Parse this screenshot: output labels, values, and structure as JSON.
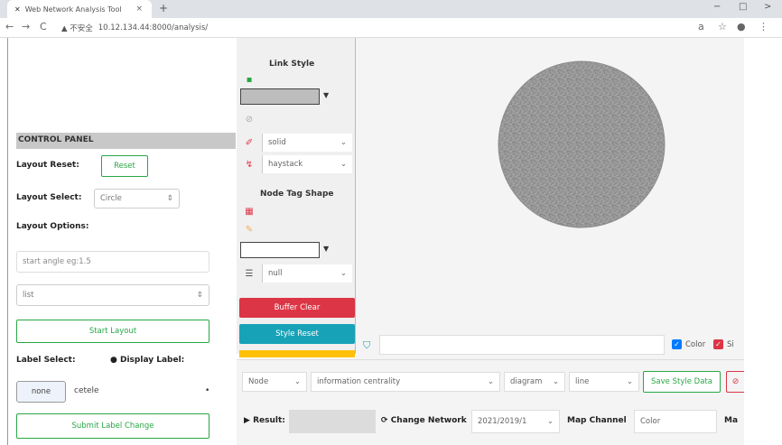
{
  "browser": {
    "tab_title": "Web Network Analysis Tool",
    "tab_close": "×",
    "new_tab": "+",
    "min": "−",
    "max": "□",
    "close_win": ">",
    "back": "←",
    "forward": "→",
    "reload": "C",
    "security_label": "▲ 不安全",
    "url": "10.12.134.44:8000/analysis/",
    "translate_icon": "a",
    "star": "☆",
    "profile": "●",
    "more": "⋮"
  },
  "control_panel": {
    "header": "CONTROL PANEL",
    "layout_reset_label": "Layout Reset:",
    "reset_button": "Reset",
    "layout_select_label": "Layout Select:",
    "layout_select_value": "Circle",
    "layout_options_label": "Layout Options:",
    "option_input_placeholder": "start angle eg:1.5",
    "option_select_value": "list",
    "start_layout_button": "Start Layout",
    "label_select_label": "Label Select:",
    "display_label_label": "Display Label:",
    "label_toggle_value": "none",
    "label_text": "cetele",
    "submit_label_button": "Submit Label Change"
  },
  "style_panel": {
    "link_style_title": "Link Style",
    "link_line_value": "solid",
    "link_curve_value": "haystack",
    "node_tag_shape_title": "Node Tag Shape",
    "node_shape_value": "null",
    "buffer_clear_button": "Buffer Clear",
    "style_reset_button": "Style Reset",
    "colors": {
      "swatch_link": "#bdbdbd",
      "swatch_node": "#ffffff"
    }
  },
  "filter": {
    "filter_icon": "filter-icon",
    "color_checkbox_label": "Color",
    "size_checkbox_label": "Si"
  },
  "bottom": {
    "node_select": "Node",
    "metric_select": "information centrality",
    "diagram_select": "diagram",
    "line_select": "line",
    "save_style_button": "Save Style Data",
    "result_label": "Result:",
    "result_value": "",
    "change_network_label": "Change Network",
    "network_select": "2021/2019/1",
    "map_channel_label": "Map Channel",
    "map_channel_value": "Color",
    "ma_label": "Ma"
  }
}
